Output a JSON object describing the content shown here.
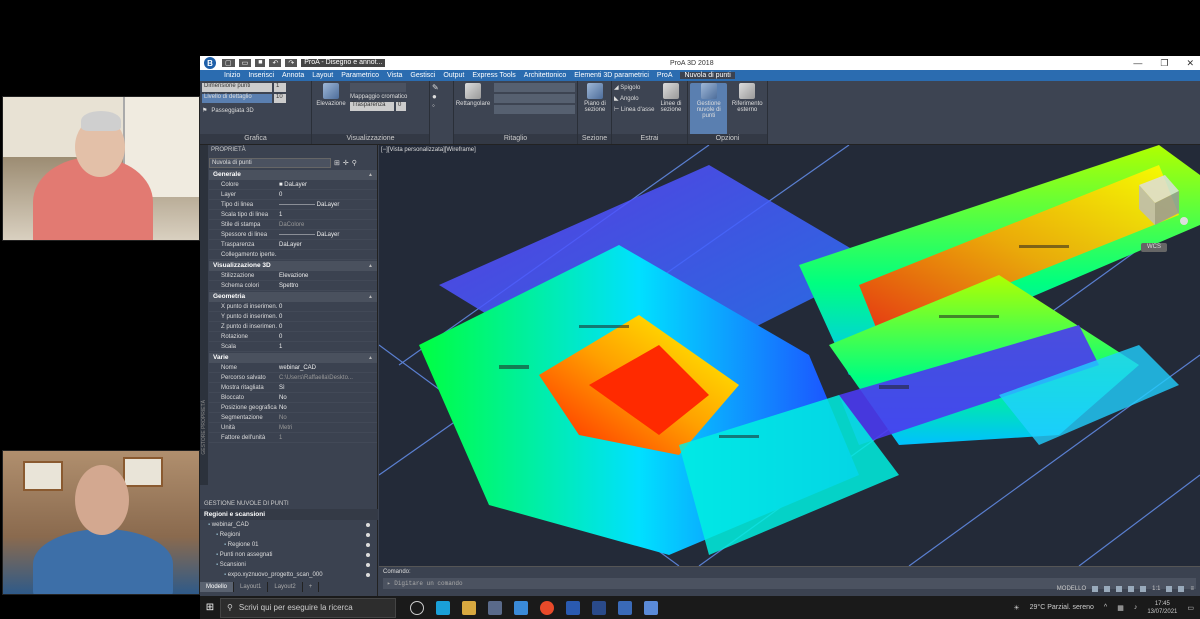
{
  "app": {
    "title": "ProA 3D 2018",
    "doc_tab": "ProA - Disegno e annot...",
    "logo": "B"
  },
  "menu": [
    "Inizio",
    "Inserisci",
    "Annota",
    "Layout",
    "Parametrico",
    "Vista",
    "Gestisci",
    "Output",
    "Express Tools",
    "Architettonico",
    "Elementi 3D parametrici",
    "ProA",
    "Nuvola di punti"
  ],
  "ribbon": {
    "grafica": {
      "label": "Grafica",
      "dim_punti": "Dimensione punti",
      "dim_val": "1",
      "livello": "Livello di dettaglio",
      "liv_val": "10",
      "passeggiata": "Passeggiata 3D"
    },
    "visualizzazione": {
      "label": "Visualizzazione",
      "elevazione": "Elevazione",
      "mappaggio": "Mappaggio cromatico",
      "trasparenza": "Trasparenza",
      "trasp_val": "0"
    },
    "ritaglio": {
      "label": "Ritaglio",
      "rettangolare": "Rettangolare"
    },
    "sezione": {
      "label": "Sezione",
      "piano": "Piano di sezione"
    },
    "estrai": {
      "label": "Estrai",
      "spigolo": "Spigolo",
      "angolo": "Angolo",
      "linea_asse": "Linea d'asse",
      "linee_sezione": "Linee di sezione"
    },
    "opzioni": {
      "label": "Opzioni",
      "gestione": "Gestione nuvole di punti",
      "riferimento": "Riferimento esterno"
    }
  },
  "properties": {
    "header": "PROPRIETÀ",
    "selector": "Nuvola di punti",
    "strip_label": "GESTORE PROPRIETÀ",
    "sections": [
      {
        "title": "Generale",
        "rows": [
          {
            "k": "Colore",
            "v": "■ DaLayer"
          },
          {
            "k": "Layer",
            "v": "0"
          },
          {
            "k": "Tipo di linea",
            "v": "—————— DaLayer"
          },
          {
            "k": "Scala tipo di linea",
            "v": "1"
          },
          {
            "k": "Stile di stampa",
            "v": "DaColore",
            "dim": true
          },
          {
            "k": "Spessore di linea",
            "v": "—————— DaLayer"
          },
          {
            "k": "Trasparenza",
            "v": "DaLayer"
          },
          {
            "k": "Collegamento iperte...",
            "v": ""
          }
        ]
      },
      {
        "title": "Visualizzazione 3D",
        "rows": [
          {
            "k": "Stilizzazione",
            "v": "Elevazione"
          },
          {
            "k": "Schema colori",
            "v": "Spettro"
          }
        ]
      },
      {
        "title": "Geometria",
        "rows": [
          {
            "k": "X punto di inserimen...",
            "v": "0"
          },
          {
            "k": "Y punto di inserimen...",
            "v": "0"
          },
          {
            "k": "Z punto di inserimen...",
            "v": "0"
          },
          {
            "k": "Rotazione",
            "v": "0"
          },
          {
            "k": "Scala",
            "v": "1"
          }
        ]
      },
      {
        "title": "Varie",
        "rows": [
          {
            "k": "Nome",
            "v": "webinar_CAD"
          },
          {
            "k": "Percorso salvato",
            "v": "C:\\Users\\Raffaella\\Deskto...",
            "dim": true
          },
          {
            "k": "Mostra ritagliata",
            "v": "Sì"
          },
          {
            "k": "Bloccato",
            "v": "No"
          },
          {
            "k": "Posizione geografica...",
            "v": "No"
          },
          {
            "k": "Segmentazione",
            "v": "No",
            "dim": true
          },
          {
            "k": "Unità",
            "v": "Metri",
            "dim": true
          },
          {
            "k": "Fattore dell'unità",
            "v": "1",
            "dim": true
          }
        ]
      }
    ]
  },
  "gestione": {
    "header": "GESTIONE NUVOLE DI PUNTI",
    "tree_header": "Regioni e scansioni",
    "items": [
      {
        "label": "webinar_CAD",
        "indent": 1
      },
      {
        "label": "Regioni",
        "indent": 2
      },
      {
        "label": "Regione 01",
        "indent": 3
      },
      {
        "label": "Punti non assegnati",
        "indent": 2
      },
      {
        "label": "Scansioni",
        "indent": 2
      },
      {
        "label": "expo.xyznuovo_progetto_scan_000",
        "indent": 3
      }
    ]
  },
  "viewport": {
    "label": "[−][Vista personalizzata][Wireframe]",
    "wcs": "WCS"
  },
  "command": {
    "label": "Comando:",
    "placeholder": "Digitare un comando"
  },
  "layout_tabs": [
    "Modello",
    "Layout1",
    "Layout2",
    "+"
  ],
  "status": {
    "modello": "MODELLO",
    "scale": "1:1"
  },
  "taskbar": {
    "search": "Scrivi qui per eseguire la ricerca",
    "weather": "29°C  Parzial. sereno",
    "time": "17:45",
    "date": "13/07/2021"
  },
  "colors": {
    "accent": "#2b6cb0",
    "panel": "#3b4250",
    "viewport": "#232a38"
  }
}
